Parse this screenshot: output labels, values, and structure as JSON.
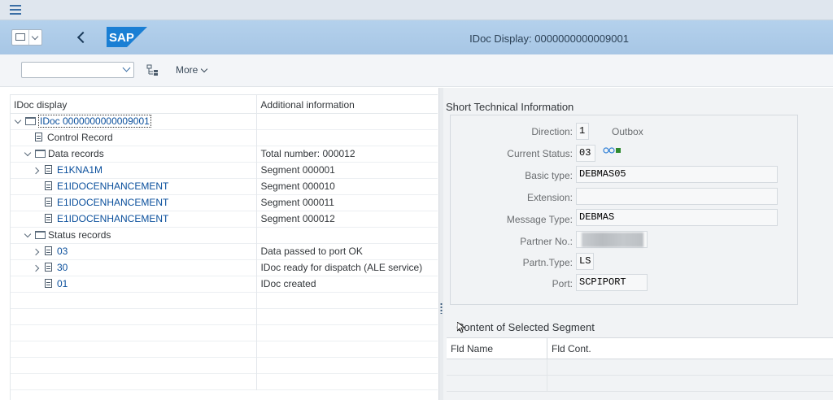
{
  "shell": {
    "title": "IDoc Display: 0000000000009001",
    "logo_text": "SAP",
    "accent": "#a8c8e8"
  },
  "toolbar": {
    "select_value": "",
    "more_label": "More"
  },
  "tree": {
    "headers": [
      "IDoc display",
      "Additional information"
    ],
    "rows": [
      {
        "label": "IDoc 0000000000009001",
        "info": ""
      },
      {
        "label": "Control Record",
        "info": ""
      },
      {
        "label": "Data records",
        "info": "Total number: 000012"
      },
      {
        "label": "E1KNA1M",
        "info": "Segment 000001"
      },
      {
        "label": "E1IDOCENHANCEMENT",
        "info": "Segment 000010"
      },
      {
        "label": "E1IDOCENHANCEMENT",
        "info": "Segment 000011"
      },
      {
        "label": "E1IDOCENHANCEMENT",
        "info": "Segment 000012"
      },
      {
        "label": "Status records",
        "info": ""
      },
      {
        "label": "03",
        "info": "Data passed to port OK"
      },
      {
        "label": "30",
        "info": "IDoc ready for dispatch (ALE service)"
      },
      {
        "label": "01",
        "info": "IDoc created"
      }
    ]
  },
  "short_info": {
    "title": "Short Technical Information",
    "direction_label": "Direction:",
    "direction_value": "1",
    "direction_text": "Outbox",
    "status_label": "Current Status:",
    "status_value": "03",
    "status_icon": "status-lights-icon",
    "basic_type_label": "Basic type:",
    "basic_type_value": "DEBMAS05",
    "extension_label": "Extension:",
    "extension_value": "",
    "message_type_label": "Message Type:",
    "message_type_value": "DEBMAS",
    "partner_no_label": "Partner No.:",
    "partn_type_label": "Partn.Type:",
    "partn_type_value": "LS",
    "port_label": "Port:",
    "port_value": "SCPIPORT"
  },
  "segment_content": {
    "title": "Content of Selected Segment",
    "headers": [
      "Fld Name",
      "Fld Cont."
    ]
  }
}
